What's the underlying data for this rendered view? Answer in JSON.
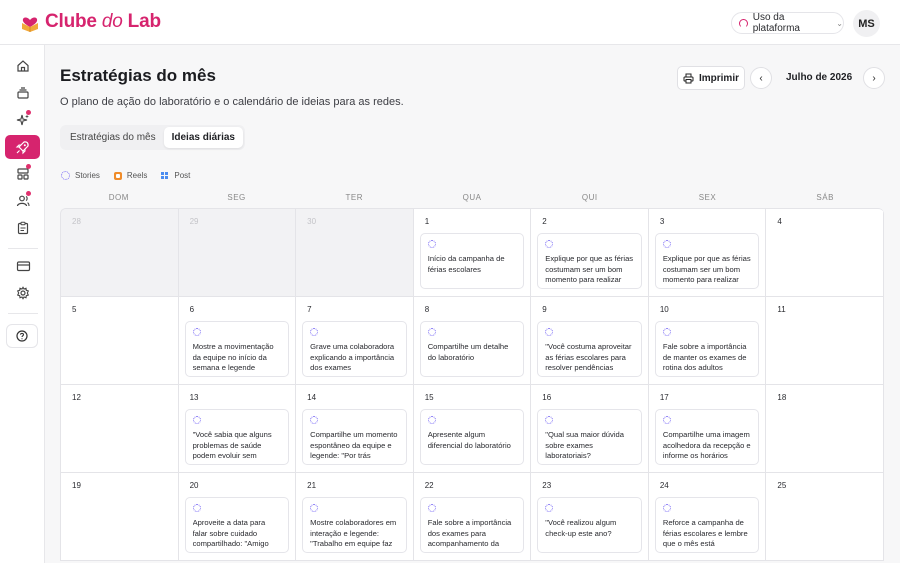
{
  "brand": {
    "name_part1": "Clube ",
    "name_part2": "do",
    "name_part3": " Lab",
    "color": "#d6246e"
  },
  "header": {
    "usage_label": "Uso da plataforma",
    "avatar_initials": "MS"
  },
  "page": {
    "title": "Estratégias do mês",
    "subtitle": "O plano de ação do laboratório e o calendário de ideias para as redes.",
    "print_label": "Imprimir",
    "month": "Julho de 2026"
  },
  "tabs": [
    {
      "label": "Estratégias do mês"
    },
    {
      "label": "Ideias diárias"
    }
  ],
  "legend": {
    "stories": "Stories",
    "reels": "Reels",
    "post": "Post"
  },
  "weekdays": [
    "DOM",
    "SEG",
    "TER",
    "QUA",
    "QUI",
    "SEX",
    "SÁB"
  ],
  "calendar": {
    "days": [
      {
        "num": "28",
        "out": true,
        "idea": ""
      },
      {
        "num": "29",
        "out": true,
        "idea": ""
      },
      {
        "num": "30",
        "out": true,
        "idea": ""
      },
      {
        "num": "1",
        "out": false,
        "idea": "Início da campanha de férias escolares"
      },
      {
        "num": "2",
        "out": false,
        "idea": "Explique por que as férias costumam ser um bom momento para realizar"
      },
      {
        "num": "3",
        "out": false,
        "idea": "Explique por que as férias costumam ser um bom momento para realizar"
      },
      {
        "num": "4",
        "out": false,
        "idea": ""
      },
      {
        "num": "5",
        "out": false,
        "idea": ""
      },
      {
        "num": "6",
        "out": false,
        "idea": "Mostre a movimentação da equipe no início da semana e legende"
      },
      {
        "num": "7",
        "out": false,
        "idea": "Grave uma colaboradora explicando a importância dos exames"
      },
      {
        "num": "8",
        "out": false,
        "idea": "Compartilhe um detalhe do laboratório"
      },
      {
        "num": "9",
        "out": false,
        "idea": "\"Você costuma aproveitar as férias escolares para resolver pendências"
      },
      {
        "num": "10",
        "out": false,
        "idea": "Fale sobre a importância de manter os exames de rotina dos adultos"
      },
      {
        "num": "11",
        "out": false,
        "idea": ""
      },
      {
        "num": "12",
        "out": false,
        "idea": ""
      },
      {
        "num": "13",
        "out": false,
        "idea": "\"Você sabia que alguns problemas de saúde podem evoluir sem"
      },
      {
        "num": "14",
        "out": false,
        "idea": "Compartilhe um momento espontâneo da equipe e legende: \"Por trás"
      },
      {
        "num": "15",
        "out": false,
        "idea": "Apresente algum diferencial do laboratório"
      },
      {
        "num": "16",
        "out": false,
        "idea": "\"Qual sua maior dúvida sobre exames laboratoriais?"
      },
      {
        "num": "17",
        "out": false,
        "idea": "Compartilhe uma imagem acolhedora da recepção e informe os horários"
      },
      {
        "num": "18",
        "out": false,
        "idea": ""
      },
      {
        "num": "19",
        "out": false,
        "idea": ""
      },
      {
        "num": "20",
        "out": false,
        "idea": "Aproveite a data para falar sobre cuidado compartilhado: \"Amigo"
      },
      {
        "num": "21",
        "out": false,
        "idea": "Mostre colaboradores em interação e legende: \"Trabalho em equipe faz"
      },
      {
        "num": "22",
        "out": false,
        "idea": "Fale sobre a importância dos exames para acompanhamento da saúde"
      },
      {
        "num": "23",
        "out": false,
        "idea": "\"Você realizou algum check-up este ano?"
      },
      {
        "num": "24",
        "out": false,
        "idea": "Reforce a campanha de férias escolares e lembre que o mês está"
      },
      {
        "num": "25",
        "out": false,
        "idea": ""
      }
    ]
  }
}
